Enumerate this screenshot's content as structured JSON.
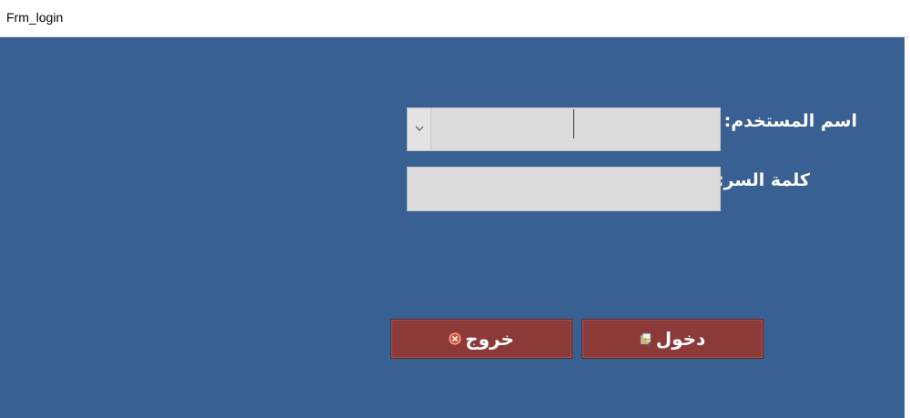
{
  "window": {
    "title": "Frm_login"
  },
  "form": {
    "username_label": "اسم المستخدم:",
    "username_value": "",
    "password_label": "كلمة السر:",
    "password_value": ""
  },
  "buttons": {
    "login_label": "دخول",
    "login_icon": "login-key-icon",
    "exit_label": "خروج",
    "exit_icon": "close-circle-icon"
  },
  "colors": {
    "background": "#386092",
    "button": "#8b3a38",
    "field": "#dcdcdc",
    "exit_icon": "#e8452c"
  }
}
